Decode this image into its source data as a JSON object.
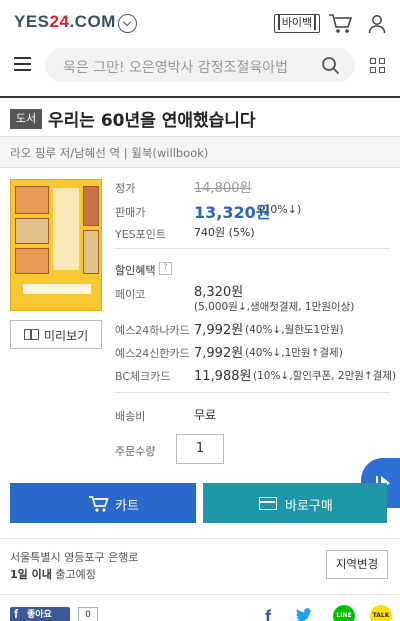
{
  "header": {
    "logo_text_left": "YES",
    "logo_text_num": "24",
    "logo_text_right": ".COM",
    "bbtn_label": "바이백",
    "search_placeholder": "욱은 그만! 오은영박사 감정조절육아법"
  },
  "product": {
    "badge": "도서",
    "title": "우리는 60년을 연애했습니다",
    "author_line": "라오 핑루 저/남혜선 역 | 윌북(willbook)",
    "preview_label": "미리보기",
    "list_price_label": "정가",
    "list_price": "14,800원",
    "sale_price_label": "판매가",
    "sale_price": "13,320원",
    "sale_discount": "(10%↓)",
    "points_label": "YES포인트",
    "points": "740원 (5%)"
  },
  "discounts": {
    "heading": "할인혜택",
    "help": "?",
    "rows": [
      {
        "label": "페이코",
        "amount": "8,320원",
        "note": "(5,000원↓,생애첫결제, 1만원이상)"
      },
      {
        "label": "예스24하나카드",
        "amount": "7,992원",
        "note": "(40%↓,월한도1만원)"
      },
      {
        "label": "예스24신한카드",
        "amount": "7,992원",
        "note": "(40%↓,1만원↑결제)"
      },
      {
        "label": "BC체크카드",
        "amount": "11,988원",
        "note": "(10%↓,할인쿠폰, 2만원↑결제)"
      }
    ]
  },
  "shipping": {
    "fee_label": "배송비",
    "fee": "무료",
    "qty_label": "주문수량",
    "qty": "1",
    "address": "서울특별시 영등포구 은행로",
    "eta_bold": "1일 이내",
    "eta_rest": " 출고예정",
    "region_button": "지역변경"
  },
  "actions": {
    "cart": "카트",
    "buy": "바로구매"
  },
  "social": {
    "fb_like": "좋아요",
    "fb_count": "0",
    "line": "LINE",
    "talk": "TALK"
  },
  "colors": {
    "accent": "#2869c9",
    "buy": "#1d96a8",
    "logo_red": "#e31e26"
  }
}
